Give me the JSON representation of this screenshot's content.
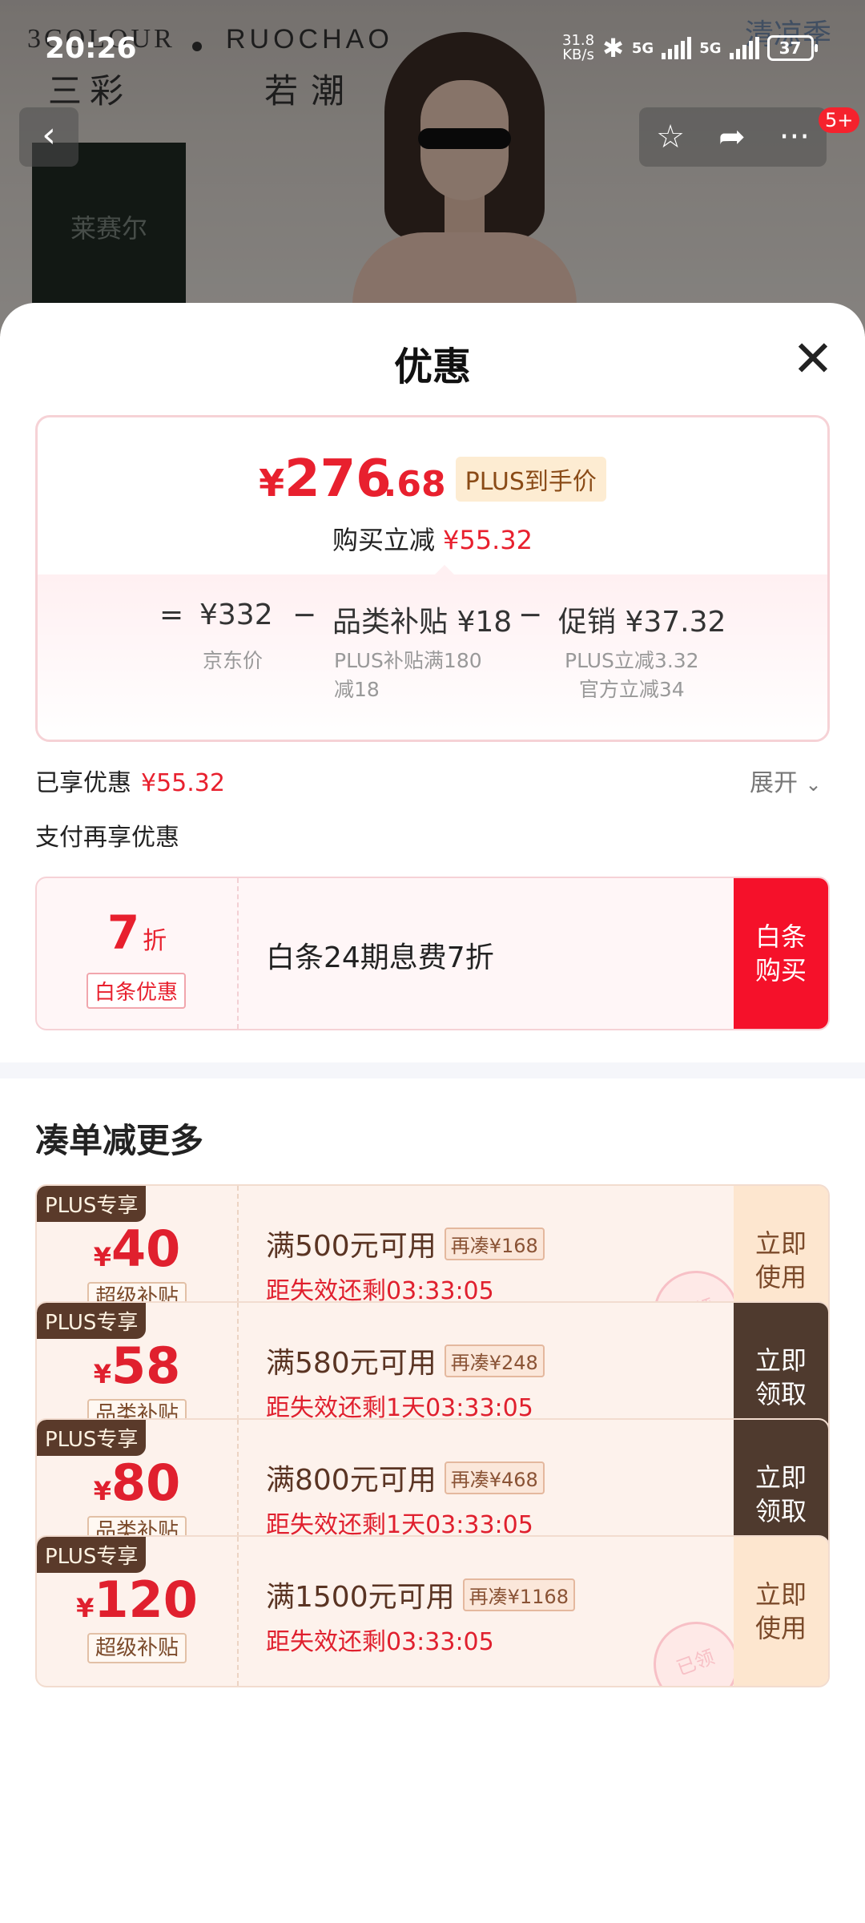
{
  "status_bar": {
    "time": "20:26",
    "net_speed_value": "31.8",
    "net_speed_unit": "KB/s",
    "network_1": "5G",
    "network_2": "5G",
    "battery": "37"
  },
  "banner": {
    "brand_left": "3COLOUR",
    "brand_left_cn": "三彩",
    "brand_right": "RUOCHAO",
    "brand_right_cn": "若潮",
    "thumb_label": "莱赛尔",
    "season_text": "清凉季",
    "badge": "5+"
  },
  "sheet": {
    "title": "优惠",
    "final_price_yen": "¥",
    "final_price_int": "276",
    "final_price_dec": ".68",
    "plus_price_label": "PLUS到手价",
    "instant_cut_label": "购买立减",
    "instant_cut_value": "¥55.32",
    "breakdown": {
      "equals": "=",
      "jd_price": "¥332",
      "jd_price_label": "京东价",
      "minus1": "−",
      "subsidy": "品类补贴 ¥18",
      "subsidy_note_1": "PLUS补贴满180",
      "subsidy_note_2": "减18",
      "minus2": "−",
      "promo": "促销 ¥37.32",
      "promo_note_1": "PLUS立减3.32",
      "promo_note_2": "官方立减34"
    },
    "enjoyed_label": "已享优惠",
    "enjoyed_value": "¥55.32",
    "expand_label": "展开",
    "pay_more_label": "支付再享优惠",
    "baitiao": {
      "discount_num": "7",
      "discount_unit": "折",
      "tag": "白条优惠",
      "text": "白条24期息费7折",
      "button_line1": "白条",
      "button_line2": "购买"
    },
    "section_title": "凑单减更多",
    "coupons": [
      {
        "plus": "PLUS专享",
        "yen": "¥",
        "amount": "40",
        "tag": "超级补贴",
        "condition": "满500元可用",
        "chip": "再凑¥168",
        "expiry": "距失效还剩03:33:05",
        "btn1": "立即",
        "btn2": "使用",
        "stamp": "已领"
      },
      {
        "plus": "PLUS专享",
        "yen": "¥",
        "amount": "58",
        "tag": "品类补贴",
        "condition": "满580元可用",
        "chip": "再凑¥248",
        "expiry": "距失效还剩1天03:33:05",
        "btn1": "立即",
        "btn2": "领取"
      },
      {
        "plus": "PLUS专享",
        "yen": "¥",
        "amount": "80",
        "tag": "品类补贴",
        "condition": "满800元可用",
        "chip": "再凑¥468",
        "expiry": "距失效还剩1天03:33:05",
        "btn1": "立即",
        "btn2": "领取"
      },
      {
        "plus": "PLUS专享",
        "yen": "¥",
        "amount": "120",
        "tag": "超级补贴",
        "condition": "满1500元可用",
        "chip": "再凑¥1168",
        "expiry": "距失效还剩03:33:05",
        "btn1": "立即",
        "btn2": "使用",
        "stamp": "已领"
      }
    ]
  },
  "colors": {
    "accent_red": "#e8202e",
    "baitiao_button": "#f5112a",
    "coupon_dark_button": "#4f3a2e",
    "coupon_light_button": "#fde6cf"
  },
  "icons": [
    "back-icon",
    "star-icon",
    "share-icon",
    "more-icon",
    "close-icon",
    "chevron-down-icon",
    "bluetooth-icon",
    "signal-icon",
    "battery-icon"
  ]
}
